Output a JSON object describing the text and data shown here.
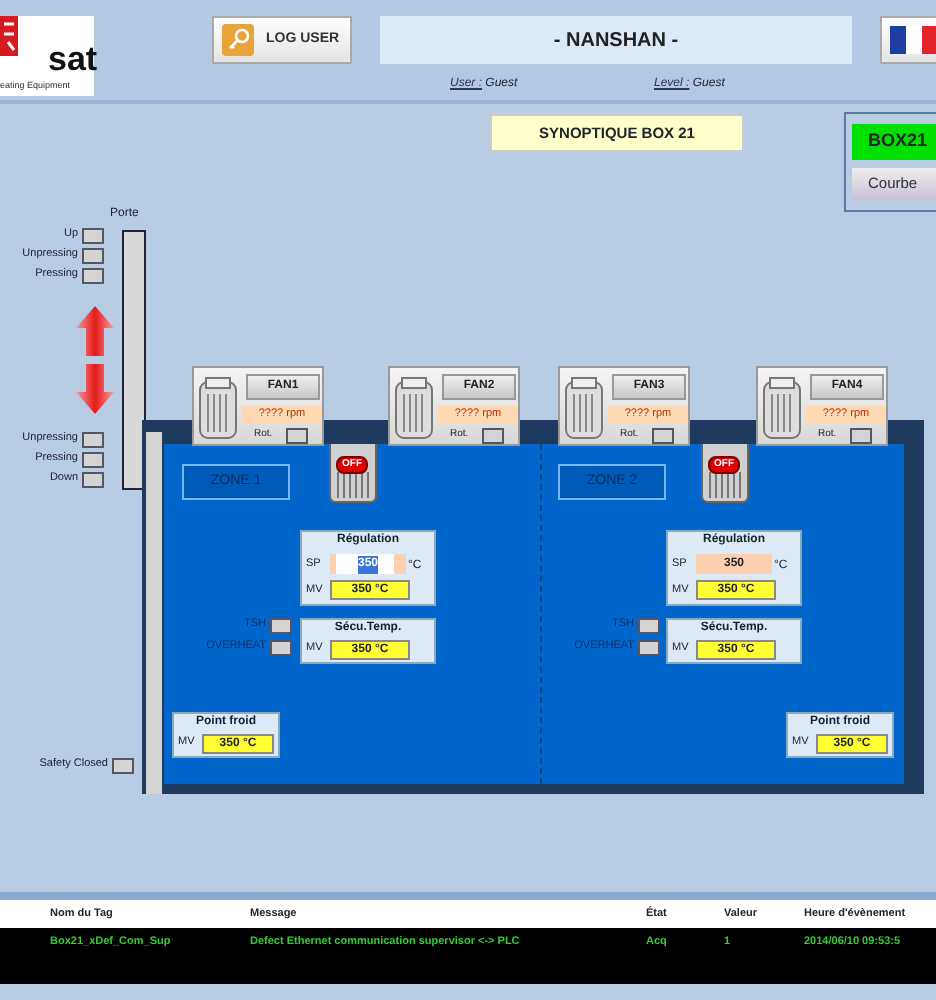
{
  "header": {
    "logo_text": "sat",
    "logo_subtitle": "eating Equipment",
    "login_button": "LOG USER",
    "site_title": "- NANSHAN -",
    "user_label": "User :",
    "user_value": "Guest",
    "level_label": "Level :",
    "level_value": "Guest"
  },
  "title": "SYNOPTIQUE BOX 21",
  "box_panel": {
    "name": "BOX21",
    "button": "Courbe"
  },
  "door": {
    "title": "Porte",
    "top_signals": [
      "Up",
      "Unpressing",
      "Pressing"
    ],
    "bottom_signals": [
      "Unpressing",
      "Pressing",
      "Down"
    ]
  },
  "fans": [
    {
      "label": "FAN1",
      "speed": "???? rpm",
      "rot_label": "Rot."
    },
    {
      "label": "FAN2",
      "speed": "???? rpm",
      "rot_label": "Rot."
    },
    {
      "label": "FAN3",
      "speed": "???? rpm",
      "rot_label": "Rot."
    },
    {
      "label": "FAN4",
      "speed": "???? rpm",
      "rot_label": "Rot."
    }
  ],
  "zones": [
    {
      "label": "ZONE 1",
      "heater": "OFF",
      "regulation": {
        "title": "Régulation",
        "sp_label": "SP",
        "sp_value": "350",
        "sp_unit": "°C",
        "sp_focused": true,
        "mv_label": "MV",
        "mv_value": "350 °C"
      },
      "safety": {
        "title": "Sécu.Temp.",
        "mv_label": "MV",
        "mv_value": "350 °C",
        "signals": [
          "TSH",
          "OVERHEAT"
        ]
      },
      "cold_point": {
        "title": "Point froid",
        "mv_label": "MV",
        "mv_value": "350 °C"
      }
    },
    {
      "label": "ZONE 2",
      "heater": "OFF",
      "regulation": {
        "title": "Régulation",
        "sp_label": "SP",
        "sp_value": "350",
        "sp_unit": "°C",
        "sp_focused": false,
        "mv_label": "MV",
        "mv_value": "350 °C"
      },
      "safety": {
        "title": "Sécu.Temp.",
        "mv_label": "MV",
        "mv_value": "350 °C",
        "signals": [
          "TSH",
          "OVERHEAT"
        ]
      },
      "cold_point": {
        "title": "Point froid",
        "mv_label": "MV",
        "mv_value": "350 °C"
      }
    }
  ],
  "safety_closed": "Safety Closed",
  "alarms": {
    "columns": [
      "Nom du Tag",
      "Message",
      "État",
      "Valeur",
      "Heure d'évènement"
    ],
    "rows": [
      [
        "Box21_xDef_Com_Sup",
        "Defect Ethernet communication supervisor <-> PLC",
        "Acq",
        "1",
        "2014/06/10 09:53:5"
      ]
    ]
  }
}
